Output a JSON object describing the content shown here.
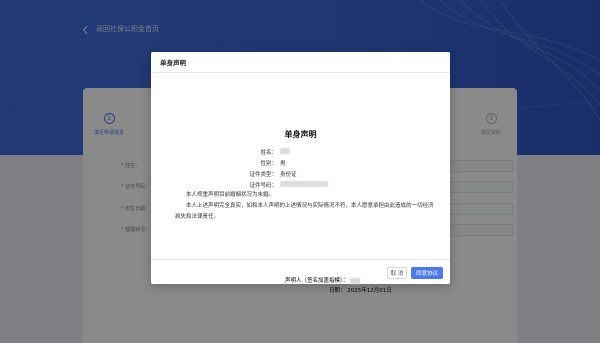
{
  "background": {
    "back_link": "返回社保公积金首页",
    "steps": [
      {
        "number": "1",
        "label": "填写申请信息"
      },
      {
        "number": "3",
        "label": "提交资料"
      }
    ],
    "form_labels": [
      "* 姓名：",
      "* 证件号码：",
      "* 出生日期：",
      "* 婚姻状况："
    ],
    "colors": {
      "brand": "#3d6bd9",
      "accent": "#4a7af0"
    }
  },
  "modal": {
    "title": "单身声明",
    "document": {
      "heading": "单身声明",
      "fields": [
        {
          "key": "姓名：",
          "value": ""
        },
        {
          "key": "性别：",
          "value": "男"
        },
        {
          "key": "证件类型：",
          "value": "身份证"
        },
        {
          "key": "证件号码：",
          "value": ""
        }
      ],
      "paragraph1": "本人郑重声明目前婚姻状况为未婚。",
      "paragraph2": "本人上述声明完全真实，如和本人声明的上述情况与实际情况不符，本人愿意承担由此造成的一切经济损失和法律责任。",
      "signer_label": "声明人（签名加盖指模）：",
      "date_label": "日期：",
      "date_value": "2025年12月01日"
    },
    "buttons": {
      "cancel": "取 消",
      "confirm": "同意协议"
    }
  }
}
